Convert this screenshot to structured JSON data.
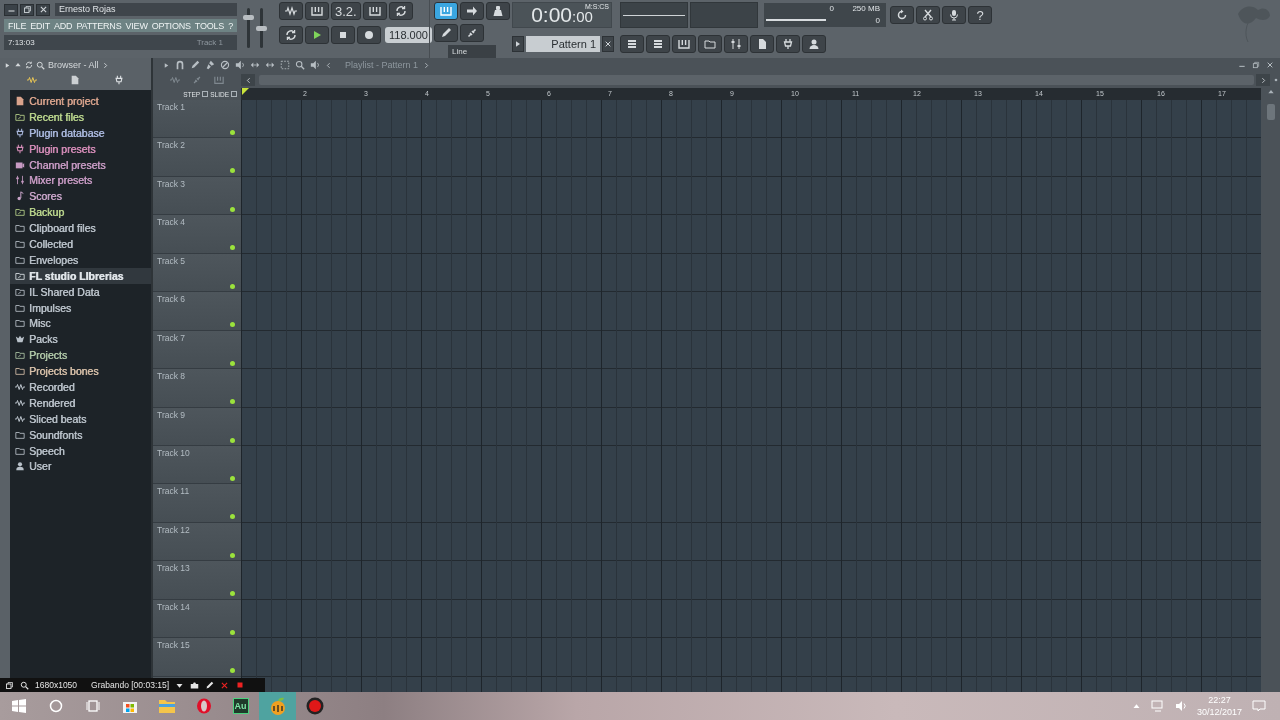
{
  "window": {
    "title": "Ernesto Rojas"
  },
  "menu": [
    "FILE",
    "EDIT",
    "ADD",
    "PATTERNS",
    "VIEW",
    "OPTIONS",
    "TOOLS",
    "?"
  ],
  "hint_bar": {
    "time": "7:13:03",
    "target": "Track 1"
  },
  "master_volume": {
    "level": 0.8
  },
  "master_pitch": {
    "level": 0.5
  },
  "transport": {
    "snap_button": "3.2.",
    "tempo": "118.000",
    "recording": false,
    "playing": false
  },
  "record_panel": {
    "typing_keyboard": true,
    "snap": "Line"
  },
  "time_display": {
    "time": "0:00",
    "centiseconds": ":00",
    "unit": "M:S:CS"
  },
  "pattern": {
    "name": "Pattern 1"
  },
  "cpu_panel": {
    "cpu": "0",
    "memory": "250 MB",
    "polyphony": "0"
  },
  "help_button": "?",
  "browser": {
    "title": "Browser - All",
    "items": [
      {
        "label": "Current project",
        "kind": "project",
        "color": "#d9a38c",
        "selected": false
      },
      {
        "label": "Recent files",
        "kind": "recent",
        "color": "#b9d48c",
        "selected": false
      },
      {
        "label": "Plugin database",
        "kind": "plugin",
        "color": "#a9b7dc",
        "selected": false
      },
      {
        "label": "Plugin presets",
        "kind": "plugin",
        "color": "#d58cb8",
        "selected": false
      },
      {
        "label": "Channel presets",
        "kind": "channel",
        "color": "#c79ac3",
        "selected": false
      },
      {
        "label": "Mixer presets",
        "kind": "mixer",
        "color": "#c79ac3",
        "selected": false
      },
      {
        "label": "Scores",
        "kind": "score",
        "color": "#c9a5c9",
        "selected": false
      },
      {
        "label": "Backup",
        "kind": "recent",
        "color": "#b9d48c",
        "selected": false
      },
      {
        "label": "Clipboard files",
        "kind": "folder",
        "color": "#b9c1c9",
        "selected": false
      },
      {
        "label": "Collected",
        "kind": "folder",
        "color": "#b9c1c9",
        "selected": false
      },
      {
        "label": "Envelopes",
        "kind": "folder",
        "color": "#b9c1c9",
        "selected": false
      },
      {
        "label": "FL studio LIbrerias",
        "kind": "linked",
        "color": "#dfe4e8",
        "selected": true
      },
      {
        "label": "IL Shared Data",
        "kind": "linked",
        "color": "#b9c1c9",
        "selected": false
      },
      {
        "label": "Impulses",
        "kind": "folder",
        "color": "#b9c1c9",
        "selected": false
      },
      {
        "label": "Misc",
        "kind": "folder",
        "color": "#b9c1c9",
        "selected": false
      },
      {
        "label": "Packs",
        "kind": "packs",
        "color": "#b9c1c9",
        "selected": false
      },
      {
        "label": "Projects",
        "kind": "linked",
        "color": "#aec6a6",
        "selected": false
      },
      {
        "label": "Projects bones",
        "kind": "folder",
        "color": "#d6bfa8",
        "selected": false
      },
      {
        "label": "Recorded",
        "kind": "wave",
        "color": "#b9c1c9",
        "selected": false
      },
      {
        "label": "Rendered",
        "kind": "wave",
        "color": "#b9c1c9",
        "selected": false
      },
      {
        "label": "Sliced beats",
        "kind": "wave",
        "color": "#b9c1c9",
        "selected": false
      },
      {
        "label": "Soundfonts",
        "kind": "folder",
        "color": "#b9c1c9",
        "selected": false
      },
      {
        "label": "Speech",
        "kind": "folder",
        "color": "#b9c1c9",
        "selected": false
      },
      {
        "label": "User",
        "kind": "user",
        "color": "#b9c1c9",
        "selected": false
      }
    ]
  },
  "playlist": {
    "title": "Playlist - Pattern 1",
    "step_label": "STEP",
    "step_checked": false,
    "slide_label": "SLIDE",
    "slide_checked": false,
    "ruler": [
      "2",
      "3",
      "4",
      "5",
      "6",
      "7",
      "8",
      "9",
      "10",
      "11",
      "12",
      "13",
      "14",
      "15",
      "16",
      "17"
    ],
    "tracks": [
      {
        "name": "Track 1",
        "active": true
      },
      {
        "name": "Track 2",
        "active": true
      },
      {
        "name": "Track 3",
        "active": true
      },
      {
        "name": "Track 4",
        "active": true
      },
      {
        "name": "Track 5",
        "active": true
      },
      {
        "name": "Track 6",
        "active": true
      },
      {
        "name": "Track 7",
        "active": true
      },
      {
        "name": "Track 8",
        "active": true
      },
      {
        "name": "Track 9",
        "active": true
      },
      {
        "name": "Track 10",
        "active": true
      },
      {
        "name": "Track 11",
        "active": true
      },
      {
        "name": "Track 12",
        "active": true
      },
      {
        "name": "Track 13",
        "active": true
      },
      {
        "name": "Track 14",
        "active": true
      },
      {
        "name": "Track 15",
        "active": true
      }
    ]
  },
  "recorder": {
    "resolution": "1680x1050",
    "status": "Grabando [00:03:15]"
  },
  "taskbar": {
    "apps": [
      {
        "kind": "start",
        "selected": false
      },
      {
        "kind": "search",
        "selected": false
      },
      {
        "kind": "taskview",
        "selected": false
      },
      {
        "kind": "store",
        "selected": false
      },
      {
        "kind": "explorer",
        "selected": false
      },
      {
        "kind": "opera",
        "selected": false
      },
      {
        "kind": "audition",
        "label": "Au",
        "selected": false
      },
      {
        "kind": "flstudio",
        "selected": true
      },
      {
        "kind": "recorder",
        "selected": false
      }
    ],
    "time": "22:27",
    "date": "30/12/2017"
  }
}
